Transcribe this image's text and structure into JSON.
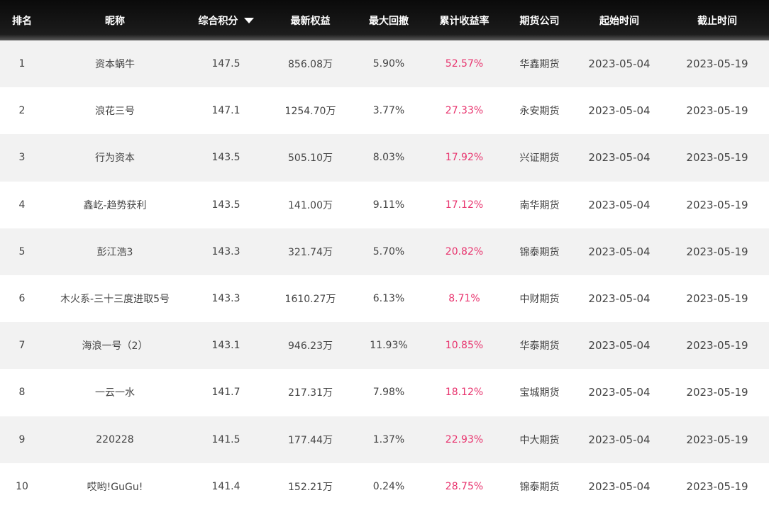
{
  "table": {
    "headers": {
      "rank": "排名",
      "nickname": "昵称",
      "score": "综合积分",
      "equity": "最新权益",
      "drawdown": "最大回撤",
      "return": "累计收益率",
      "company": "期货公司",
      "start": "起始时间",
      "end": "截止时间"
    },
    "sort_indicator": "sort-desc-triangle-icon",
    "colors": {
      "header_bg": "#111111",
      "return_color": "#e8346e",
      "row_alt_bg": "#f2f2f2"
    },
    "rows": [
      {
        "rank": "1",
        "nickname": "资本蜗牛",
        "score": "147.5",
        "equity": "856.08万",
        "drawdown": "5.90%",
        "return": "52.57%",
        "company": "华鑫期货",
        "start": "2023-05-04",
        "end": "2023-05-19"
      },
      {
        "rank": "2",
        "nickname": "浪花三号",
        "score": "147.1",
        "equity": "1254.70万",
        "drawdown": "3.77%",
        "return": "27.33%",
        "company": "永安期货",
        "start": "2023-05-04",
        "end": "2023-05-19"
      },
      {
        "rank": "3",
        "nickname": "行为资本",
        "score": "143.5",
        "equity": "505.10万",
        "drawdown": "8.03%",
        "return": "17.92%",
        "company": "兴证期货",
        "start": "2023-05-04",
        "end": "2023-05-19"
      },
      {
        "rank": "4",
        "nickname": "鑫屹-趋势获利",
        "score": "143.5",
        "equity": "141.00万",
        "drawdown": "9.11%",
        "return": "17.12%",
        "company": "南华期货",
        "start": "2023-05-04",
        "end": "2023-05-19"
      },
      {
        "rank": "5",
        "nickname": "彭江浩3",
        "score": "143.3",
        "equity": "321.74万",
        "drawdown": "5.70%",
        "return": "20.82%",
        "company": "锦泰期货",
        "start": "2023-05-04",
        "end": "2023-05-19"
      },
      {
        "rank": "6",
        "nickname": "木火系-三十三度进取5号",
        "score": "143.3",
        "equity": "1610.27万",
        "drawdown": "6.13%",
        "return": "8.71%",
        "company": "中财期货",
        "start": "2023-05-04",
        "end": "2023-05-19"
      },
      {
        "rank": "7",
        "nickname": "海浪一号（2）",
        "score": "143.1",
        "equity": "946.23万",
        "drawdown": "11.93%",
        "return": "10.85%",
        "company": "华泰期货",
        "start": "2023-05-04",
        "end": "2023-05-19"
      },
      {
        "rank": "8",
        "nickname": "一云一水",
        "score": "141.7",
        "equity": "217.31万",
        "drawdown": "7.98%",
        "return": "18.12%",
        "company": "宝城期货",
        "start": "2023-05-04",
        "end": "2023-05-19"
      },
      {
        "rank": "9",
        "nickname": "220228",
        "score": "141.5",
        "equity": "177.44万",
        "drawdown": "1.37%",
        "return": "22.93%",
        "company": "中大期货",
        "start": "2023-05-04",
        "end": "2023-05-19"
      },
      {
        "rank": "10",
        "nickname": "哎哟!GuGu!",
        "score": "141.4",
        "equity": "152.21万",
        "drawdown": "0.24%",
        "return": "28.75%",
        "company": "锦泰期货",
        "start": "2023-05-04",
        "end": "2023-05-19"
      }
    ]
  }
}
